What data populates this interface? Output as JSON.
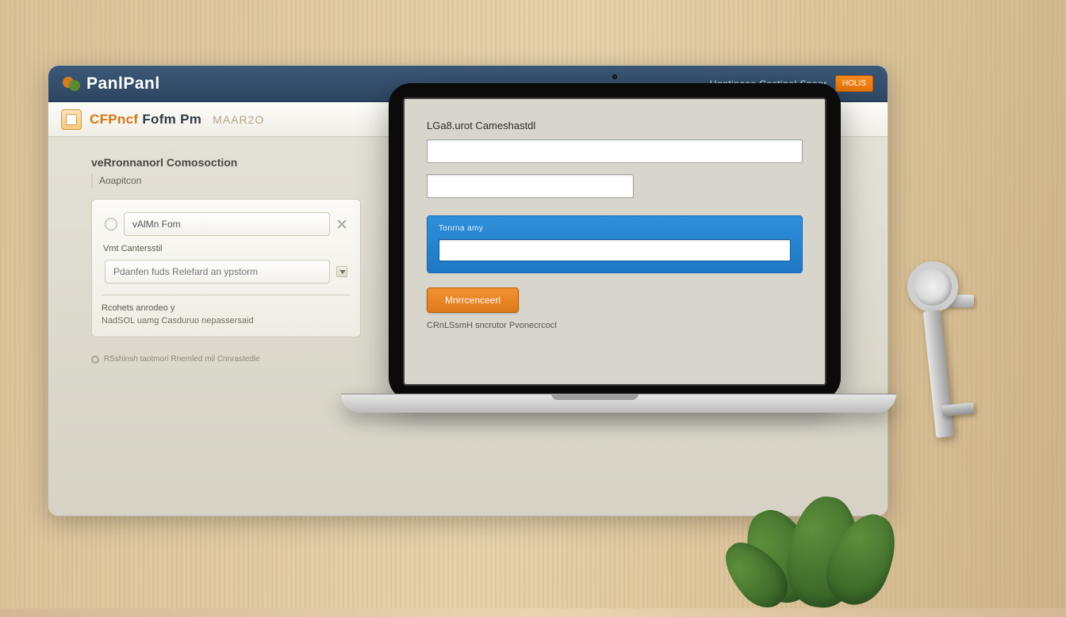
{
  "topbar": {
    "brand": "PanlPanl",
    "link": "Ugntinase Castinel Spanr",
    "button": "HOLIS"
  },
  "subbar": {
    "title_main": "CFPncf",
    "title_rest": " Fofm Pm",
    "title_code": "MAAR2O"
  },
  "sidebar": {
    "heading": "veRronnanorl Comosoction",
    "subheading": "Aoapitcon",
    "form_name_label": "vAlMn Fom",
    "vmt_label": "Vmt Cantersstil",
    "contest_placeholder": "Pdanfen fuds Relefard an ypstorm",
    "section_h": "Rcohets anrodeo y",
    "note": "NadSOL uamg Casduruo nepassersaid",
    "footer": "RSshinsh taotmori Rnemled mil Cnnrastedle"
  },
  "screen": {
    "title": "LGa8.urot Cameshastdl",
    "hl_label": "Tonrna amy",
    "button": "Mnrrcenceerl",
    "note": "CRnLSsmH sncrutor Pvonecrcocl"
  }
}
